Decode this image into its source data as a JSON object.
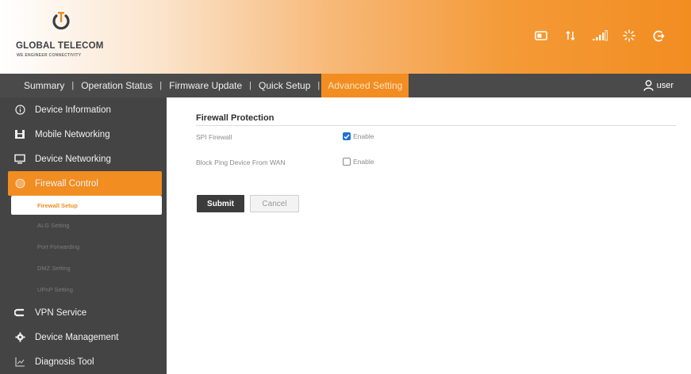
{
  "brand": {
    "name": "GLOBAL TELECOM",
    "tagline": "WE ENGINEER CONNECTIVITY",
    "accent_color": "#f28d21"
  },
  "status_icons": [
    "sim-icon",
    "data-transfer-icon",
    "signal-strength-icon",
    "wifi-activity-icon",
    "logout-icon"
  ],
  "nav": {
    "items": [
      {
        "label": "Summary",
        "active": false
      },
      {
        "label": "Operation Status",
        "active": false
      },
      {
        "label": "Firmware Update",
        "active": false
      },
      {
        "label": "Quick Setup",
        "active": false
      },
      {
        "label": "Advanced Setting",
        "active": true
      }
    ],
    "separator": "|",
    "user_label": "user"
  },
  "sidebar": {
    "items": [
      {
        "label": "Device Information",
        "icon": "info-icon"
      },
      {
        "label": "Mobile Networking",
        "icon": "mobile-network-icon"
      },
      {
        "label": "Device Networking",
        "icon": "monitor-icon"
      },
      {
        "label": "Firewall Control",
        "icon": "firewall-icon",
        "active": true
      }
    ],
    "subitems": [
      {
        "label": "Firewall Setup",
        "active": true
      },
      {
        "label": "ALG Setting"
      },
      {
        "label": "Port Forwarding"
      },
      {
        "label": "DMZ Setting"
      },
      {
        "label": "UPnP Setting"
      }
    ],
    "items_after": [
      {
        "label": "VPN Service",
        "icon": "vpn-icon"
      },
      {
        "label": "Device Management",
        "icon": "gear-icon"
      },
      {
        "label": "Diagnosis Tool",
        "icon": "diagnosis-icon"
      }
    ]
  },
  "main": {
    "section_title": "Firewall Protection",
    "rows": [
      {
        "label": "SPI Firewall",
        "option": "Enable",
        "checked": true
      },
      {
        "label": "Block Ping Device From WAN",
        "option": "Enable",
        "checked": false
      }
    ],
    "submit_label": "Submit",
    "cancel_label": "Cancel"
  }
}
